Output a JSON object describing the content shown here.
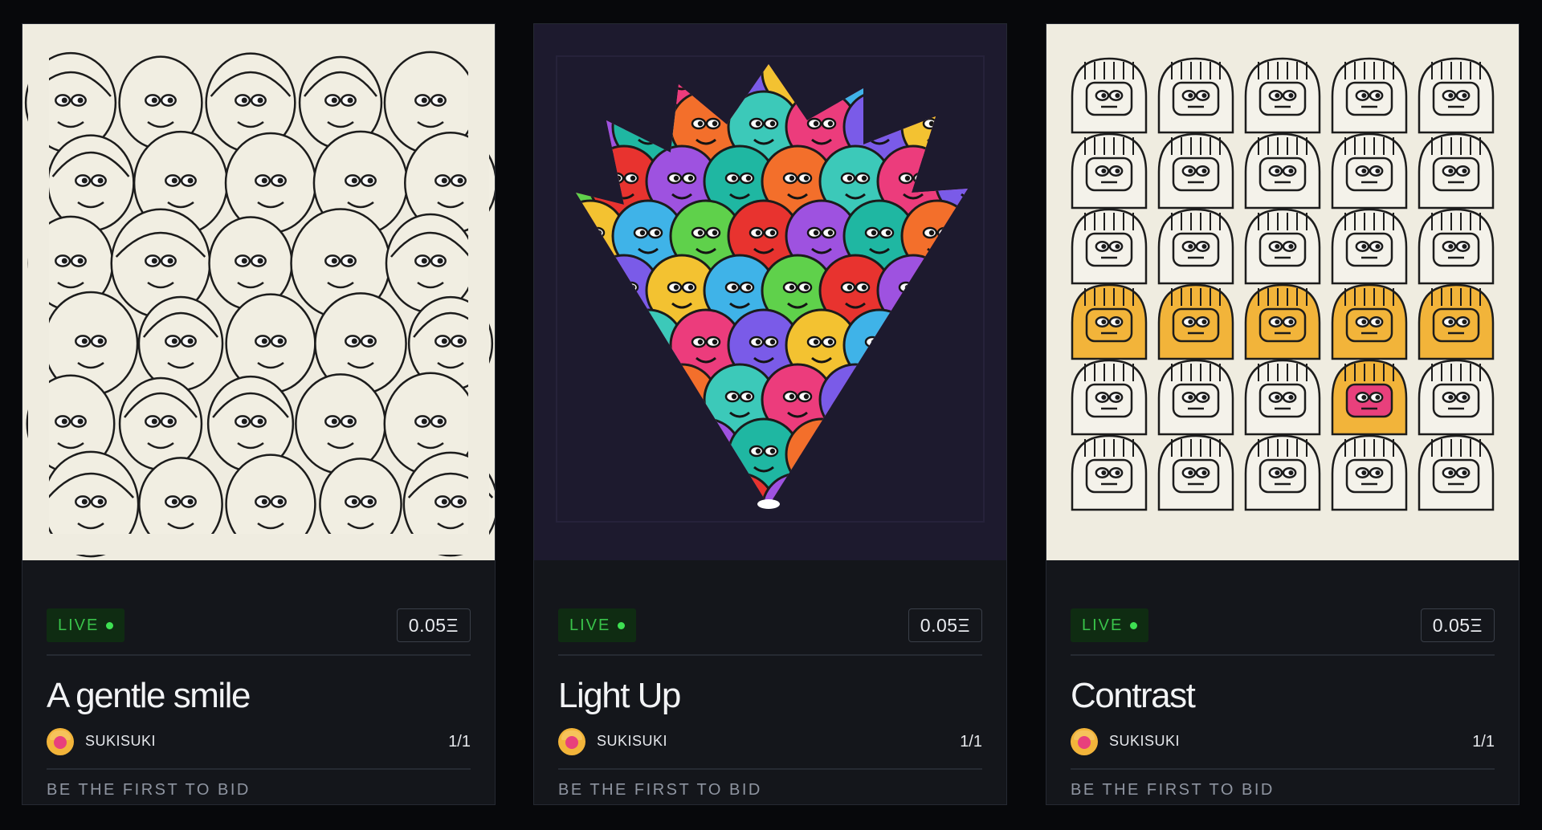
{
  "cards": [
    {
      "status": "LIVE",
      "price": "0.05Ξ",
      "title": "A gentle smile",
      "artist": "SUKISUKI",
      "edition": "1/1",
      "cta": "BE THE FIRST TO BID",
      "artwork_background": "#efece0"
    },
    {
      "status": "LIVE",
      "price": "0.05Ξ",
      "title": "Light Up",
      "artist": "SUKISUKI",
      "edition": "1/1",
      "cta": "BE THE FIRST TO BID",
      "artwork_background": "#1d1a2e"
    },
    {
      "status": "LIVE",
      "price": "0.05Ξ",
      "title": "Contrast",
      "artist": "SUKISUKI",
      "edition": "1/1",
      "cta": "BE THE FIRST TO BID",
      "artwork_background": "#efece0"
    }
  ],
  "colors": {
    "page_background": "#07080b",
    "card_background": "#14161b",
    "live_green": "#39c34a",
    "accent_yellow": "#f2b43a"
  }
}
